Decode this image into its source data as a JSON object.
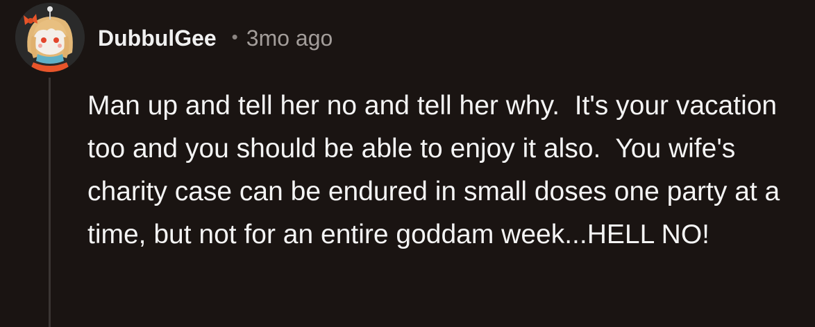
{
  "comment": {
    "username": "DubbulGee",
    "separator": "•",
    "timestamp": "3mo ago",
    "avatar_icon": "snoo-avatar-icon",
    "body": "Man up and tell her no and tell her why.  It's your vacation too and you should be able to enjoy it also.  You wife's charity case can be endured in small doses one party at a time, but not for an entire goddam week...HELL NO!"
  },
  "colors": {
    "background": "#1a1412",
    "text": "#f4f4f4",
    "muted_text": "#a39d9a",
    "thread_line": "#3a3533"
  }
}
